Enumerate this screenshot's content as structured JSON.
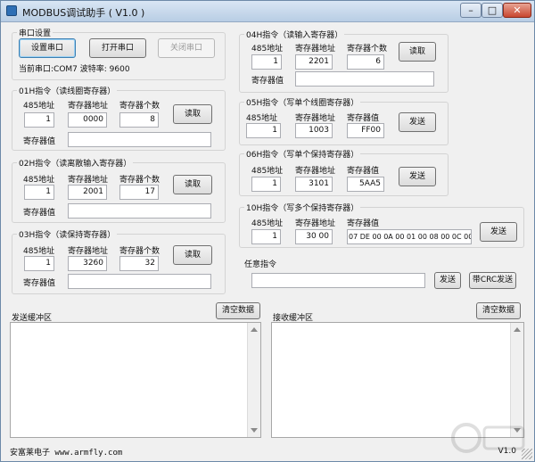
{
  "window": {
    "title": "MODBUS调试助手 ( V1.0 )",
    "minimize": "–",
    "maximize": "□",
    "close": "✕"
  },
  "serial": {
    "group_title": "串口设置",
    "setup_button": "设置串口",
    "open_button": "打开串口",
    "close_button": "关闭串口",
    "status": "当前串口:COM7 波特率: 9600"
  },
  "labels": {
    "addr485": "485地址",
    "reg_addr": "寄存器地址",
    "reg_count": "寄存器个数",
    "reg_value": "寄存器值",
    "read": "读取",
    "send": "发送"
  },
  "cmd01": {
    "title": "01H指令（读线圈寄存器）",
    "addr485": "1",
    "reg_addr": "0000",
    "reg_count": "8",
    "reg_value": ""
  },
  "cmd02": {
    "title": "02H指令（读离散输入寄存器）",
    "addr485": "1",
    "reg_addr": "2001",
    "reg_count": "17",
    "reg_value": ""
  },
  "cmd03": {
    "title": "03H指令（读保持寄存器）",
    "addr485": "1",
    "reg_addr": "3260",
    "reg_count": "32",
    "reg_value": ""
  },
  "cmd04": {
    "title": "04H指令（读输入寄存器）",
    "addr485": "1",
    "reg_addr": "2201",
    "reg_count": "6",
    "reg_value": ""
  },
  "cmd05": {
    "title": "05H指令（写单个线圈寄存器）",
    "addr485": "1",
    "reg_addr": "1003",
    "reg_value": "FF00"
  },
  "cmd06": {
    "title": "06H指令（写单个保持寄存器）",
    "addr485": "1",
    "reg_addr": "3101",
    "reg_value": "5AA5"
  },
  "cmd10": {
    "title": "10H指令（写多个保持寄存器）",
    "addr485": "1",
    "reg_addr": "30 00",
    "reg_value": "07 DE 00 0A 00 01 00 08 00 0C 00"
  },
  "any_cmd": {
    "title": "任意指令",
    "value": "",
    "send": "发送",
    "send_crc": "带CRC发送"
  },
  "buffers": {
    "send_title": "发送缓冲区",
    "recv_title": "接收缓冲区",
    "clear": "清空数据",
    "send_content": "",
    "recv_content": ""
  },
  "status_bar": {
    "text": "安富莱电子 www.armfly.com",
    "version": "V1.0"
  }
}
